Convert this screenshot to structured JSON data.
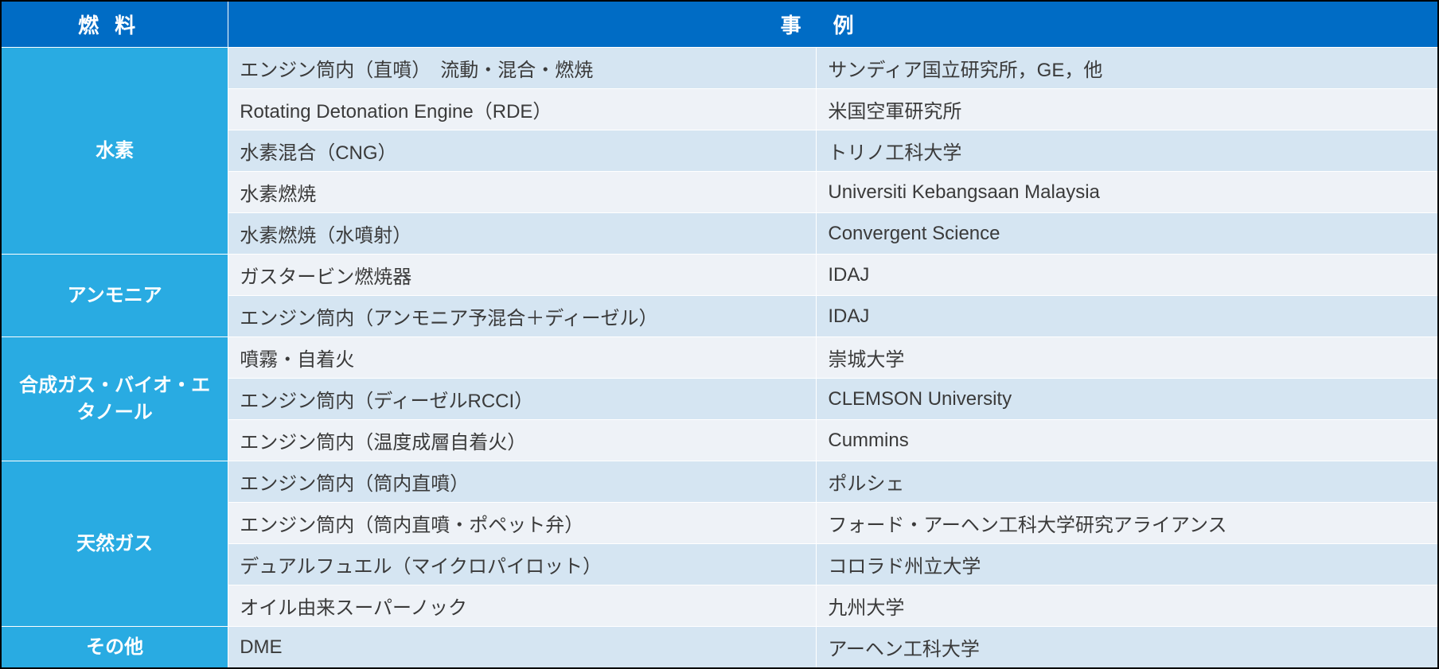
{
  "headers": {
    "fuel": "燃料",
    "example": "事例"
  },
  "groups": [
    {
      "fuel": "水素",
      "rows": [
        {
          "desc": "エンジン筒内（直噴）　流動・混合・燃焼",
          "org": "サンディア国立研究所，GE，他",
          "shade": "light"
        },
        {
          "desc": "Rotating Detonation Engine（RDE）",
          "org": "米国空軍研究所",
          "shade": "dark"
        },
        {
          "desc": "水素混合（CNG）",
          "org": "トリノ工科大学",
          "shade": "light"
        },
        {
          "desc": "水素燃焼",
          "org": "Universiti Kebangsaan Malaysia",
          "shade": "dark"
        },
        {
          "desc": "水素燃焼（水噴射）",
          "org": "Convergent Science",
          "shade": "light"
        }
      ]
    },
    {
      "fuel": "アンモニア",
      "rows": [
        {
          "desc": "ガスタービン燃焼器",
          "org": "IDAJ",
          "shade": "dark"
        },
        {
          "desc": "エンジン筒内（アンモニア予混合＋ディーゼル）",
          "org": "IDAJ",
          "shade": "light"
        }
      ]
    },
    {
      "fuel": "合成ガス・バイオ・エタノール",
      "rows": [
        {
          "desc": "噴霧・自着火",
          "org": "崇城大学",
          "shade": "dark"
        },
        {
          "desc": "エンジン筒内（ディーゼルRCCI）",
          "org": "CLEMSON University",
          "shade": "light"
        },
        {
          "desc": "エンジン筒内（温度成層自着火）",
          "org": "Cummins",
          "shade": "dark"
        }
      ]
    },
    {
      "fuel": "天然ガス",
      "rows": [
        {
          "desc": "エンジン筒内（筒内直噴）",
          "org": "ポルシェ",
          "shade": "light"
        },
        {
          "desc": "エンジン筒内（筒内直噴・ポペット弁）",
          "org": "フォード・アーヘン工科大学研究アライアンス",
          "shade": "dark"
        },
        {
          "desc": "デュアルフュエル（マイクロパイロット）",
          "org": "コロラド州立大学",
          "shade": "light"
        },
        {
          "desc": "オイル由来スーパーノック",
          "org": "九州大学",
          "shade": "dark"
        }
      ]
    },
    {
      "fuel": "その他",
      "rows": [
        {
          "desc": "DME",
          "org": "アーヘン工科大学",
          "shade": "light"
        }
      ]
    }
  ]
}
